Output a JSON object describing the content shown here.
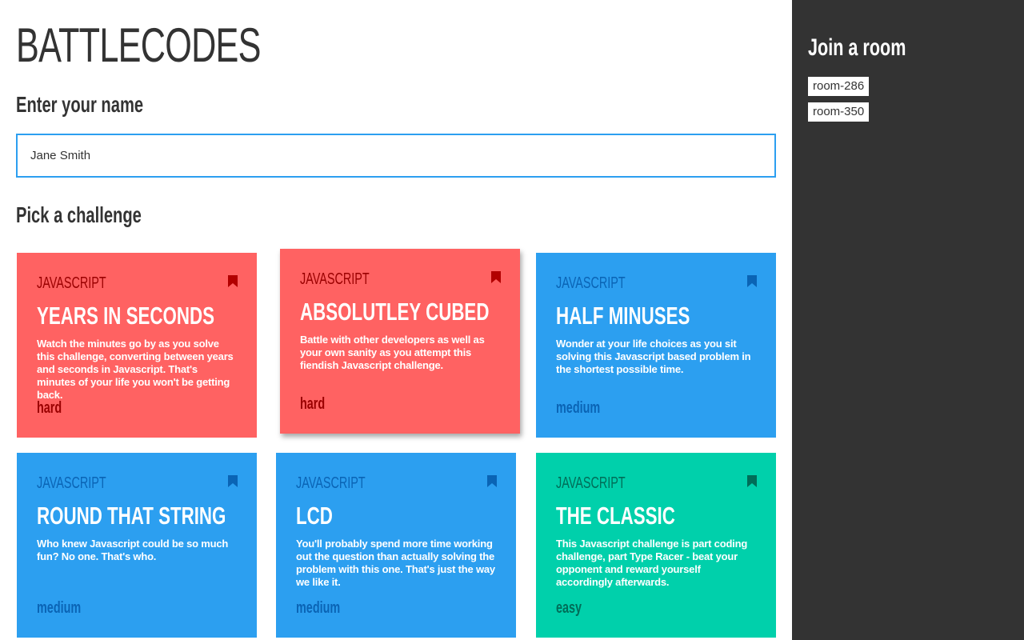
{
  "app": {
    "title": "BATTLECODES"
  },
  "name_section": {
    "heading": "Enter your name",
    "input_value": "Jane Smith"
  },
  "challenge_section": {
    "heading": "Pick a challenge"
  },
  "challenges": [
    {
      "language": "JAVASCRIPT",
      "title": "YEARS IN SECONDS",
      "description": "Watch the minutes go by as you solve this challenge, converting between years and seconds in Javascript. That's minutes of your life you won't be getting back.",
      "difficulty": "hard",
      "color": "#ff6262"
    },
    {
      "language": "JAVASCRIPT",
      "title": "ABSOLUTLEY CUBED",
      "description": "Battle with other developers as well as your own sanity as you attempt this fiendish Javascript challenge.",
      "difficulty": "hard",
      "color": "#ff6262"
    },
    {
      "language": "JAVASCRIPT",
      "title": "HALF MINUSES",
      "description": "Wonder at your life choices as you sit solving this Javascript based problem in the shortest possible time.",
      "difficulty": "medium",
      "color": "#2c9ff0"
    },
    {
      "language": "JAVASCRIPT",
      "title": "ROUND THAT STRING",
      "description": "Who knew Javascript could be so much fun? No one. That's who.",
      "difficulty": "medium",
      "color": "#2c9ff0"
    },
    {
      "language": "JAVASCRIPT",
      "title": "LCD",
      "description": "You'll probably spend more time working out the question than actually solving the problem with this one. That's just the way we like it.",
      "difficulty": "medium",
      "color": "#2c9ff0"
    },
    {
      "language": "JAVASCRIPT",
      "title": "THE CLASSIC",
      "description": "This Javascript challenge is part coding challenge, part Type Racer - beat your opponent and reward yourself accordingly afterwards.",
      "difficulty": "easy",
      "color": "#00d0ab"
    }
  ],
  "sidebar": {
    "title": "Join a room",
    "rooms": [
      "room-286",
      "room-350"
    ]
  }
}
